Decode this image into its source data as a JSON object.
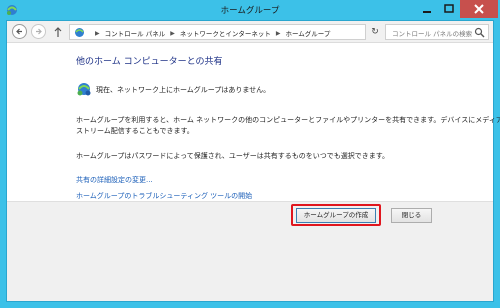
{
  "window": {
    "title": "ホームグループ"
  },
  "nav": {
    "breadcrumbs": [
      "コントロール パネル",
      "ネットワークとインターネット",
      "ホームグループ"
    ],
    "search_placeholder": "コントロール パネルの検索"
  },
  "content": {
    "heading": "他のホーム コンピューターとの共有",
    "status": "現在、ネットワーク上にホームグループはありません。",
    "paragraph1_line1": "ホームグループを利用すると、ホーム ネットワークの他のコンピューターとファイルやプリンターを共有できます。デバイスにメディアを",
    "paragraph1_line2": "ストリーム配信することもできます。",
    "paragraph2": "ホームグループはパスワードによって保護され、ユーザーは共有するものをいつでも選択できます。",
    "link_advanced": "共有の詳細設定の変更...",
    "link_troubleshoot": "ホームグループのトラブルシューティング ツールの開始"
  },
  "footer": {
    "create_label": "ホームグループの作成",
    "close_label": "閉じる"
  },
  "colors": {
    "window_frame": "#3cc1e8",
    "highlight": "#e0161e",
    "link": "#1a5eb8",
    "heading": "#1e3287"
  },
  "icons": {
    "app": "homegroup-icon",
    "status": "homegroup-network-icon",
    "search": "search-icon",
    "refresh": "refresh-icon"
  }
}
